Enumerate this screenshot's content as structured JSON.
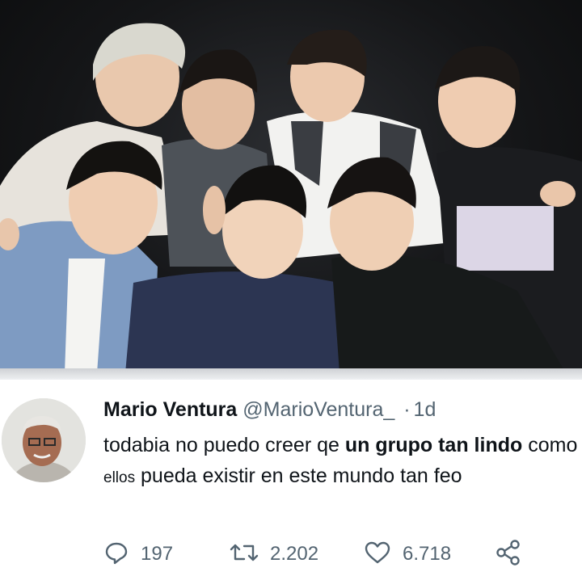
{
  "tweet": {
    "author_name": "Mario Ventura",
    "handle": "@MarioVentura_",
    "separator": "·",
    "time": "1d",
    "text": {
      "part1": "todabia no puedo creer qe",
      "part2": "un grupo tan lindo",
      "part3": "como",
      "part4": "ellos",
      "part5": "pueda existir en este mundo tan feo"
    }
  },
  "actions": {
    "reply_count": "197",
    "retweet_count": "2.202",
    "like_count": "6.718"
  },
  "icons": {
    "reply": "reply-icon",
    "retweet": "retweet-icon",
    "like": "heart-icon",
    "share": "share-icon"
  },
  "colors": {
    "text": "#0f1419",
    "muted": "#536471",
    "photo_bg": "#151618"
  }
}
